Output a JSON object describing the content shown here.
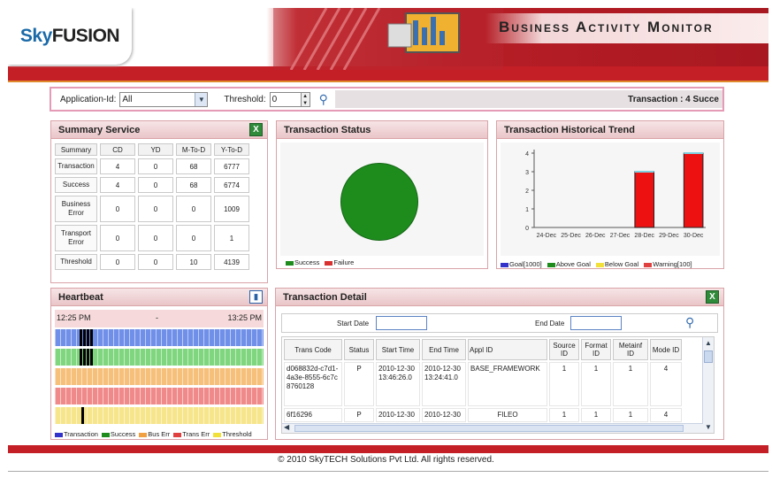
{
  "header": {
    "logo_sky": "Sky",
    "logo_fusion": "FUSION",
    "title": "Business Activity Monitor"
  },
  "filter": {
    "application_label": "Application-Id:",
    "application_value": "All",
    "threshold_label": "Threshold:",
    "threshold_value": "0",
    "transaction_text": "Transaction : 4   Succe"
  },
  "summary": {
    "title": "Summary Service",
    "columns": [
      "Summary",
      "CD",
      "YD",
      "M-To-D",
      "Y-To-D"
    ],
    "rows": [
      {
        "label": "Transaction",
        "cd": "4",
        "yd": "0",
        "mtd": "68",
        "ytd": "6777"
      },
      {
        "label": "Success",
        "cd": "4",
        "yd": "0",
        "mtd": "68",
        "ytd": "6774"
      },
      {
        "label": "Business Error",
        "cd": "0",
        "yd": "0",
        "mtd": "0",
        "ytd": "1009"
      },
      {
        "label": "Transport Error",
        "cd": "0",
        "yd": "0",
        "mtd": "0",
        "ytd": "1"
      },
      {
        "label": "Threshold",
        "cd": "0",
        "yd": "0",
        "mtd": "10",
        "ytd": "4139"
      }
    ]
  },
  "status": {
    "title": "Transaction Status",
    "legend": [
      {
        "label": "Success",
        "color": "#1d8c1d"
      },
      {
        "label": "Failure",
        "color": "#d93030"
      }
    ]
  },
  "trend": {
    "title": "Transaction Historical Trend",
    "legend": [
      {
        "label": "Goal[1000]",
        "color": "#3333cc"
      },
      {
        "label": "Above Goal",
        "color": "#1d8c1d"
      },
      {
        "label": "Below Goal",
        "color": "#f2e03a"
      },
      {
        "label": "Warning[100]",
        "color": "#e04040"
      }
    ]
  },
  "chart_data": {
    "type": "bar",
    "categories": [
      "24-Dec",
      "25-Dec",
      "26-Dec",
      "27-Dec",
      "28-Dec",
      "29-Dec",
      "30-Dec"
    ],
    "series": [
      {
        "name": "Warning[100]",
        "values": [
          0,
          0,
          0,
          0,
          3,
          0,
          4
        ]
      }
    ],
    "ylim": [
      0,
      4
    ],
    "yticks": [
      "0",
      "1",
      "2",
      "3",
      "4"
    ],
    "grid": false,
    "legend_position": "bottom"
  },
  "heartbeat": {
    "title": "Heartbeat",
    "time_start": "12:25 PM",
    "time_mid": "-",
    "time_end": "13:25 PM",
    "lanes": [
      {
        "name": "Transaction",
        "color": "#6f8fe8",
        "marks": 4
      },
      {
        "name": "Success",
        "color": "#7fd67f",
        "marks": 4
      },
      {
        "name": "Bus Err",
        "color": "#f6bf7a",
        "marks": 0
      },
      {
        "name": "Trans Err",
        "color": "#f08a8a",
        "marks": 0
      },
      {
        "name": "Threshold",
        "color": "#f6e58a",
        "marks": 1
      }
    ],
    "legend": [
      {
        "label": "Transaction",
        "color": "#3333cc"
      },
      {
        "label": "Success",
        "color": "#1d8c1d"
      },
      {
        "label": "Bus Err",
        "color": "#f0a040"
      },
      {
        "label": "Trans Err",
        "color": "#e04040"
      },
      {
        "label": "Threshold",
        "color": "#f2e03a"
      }
    ]
  },
  "detail": {
    "title": "Transaction Detail",
    "start_label": "Start Date",
    "end_label": "End Date",
    "columns": [
      "Trans Code",
      "Status",
      "Start Time",
      "End Time",
      "Appl ID",
      "Source ID",
      "Format ID",
      "Metainf ID",
      "Mode ID"
    ],
    "rows": [
      {
        "code": "d068832d-c7d1-4a3e-8555-6c7c8760128",
        "status": "P",
        "start": "2010-12-30 13:46:26.0",
        "end": "2010-12-30 13:24:41.0",
        "appl": "BASE_FRAMEWORK",
        "source": "1",
        "format": "1",
        "metainf": "1",
        "mode": "4"
      },
      {
        "code": "6f16296",
        "status": "P",
        "start": "2010-12-30",
        "end": "2010-12-30",
        "appl": "FILEO",
        "source": "1",
        "format": "1",
        "metainf": "1",
        "mode": "4"
      }
    ]
  },
  "footer": {
    "text": "© 2010 SkyTECH Solutions Pvt Ltd. All rights reserved."
  }
}
